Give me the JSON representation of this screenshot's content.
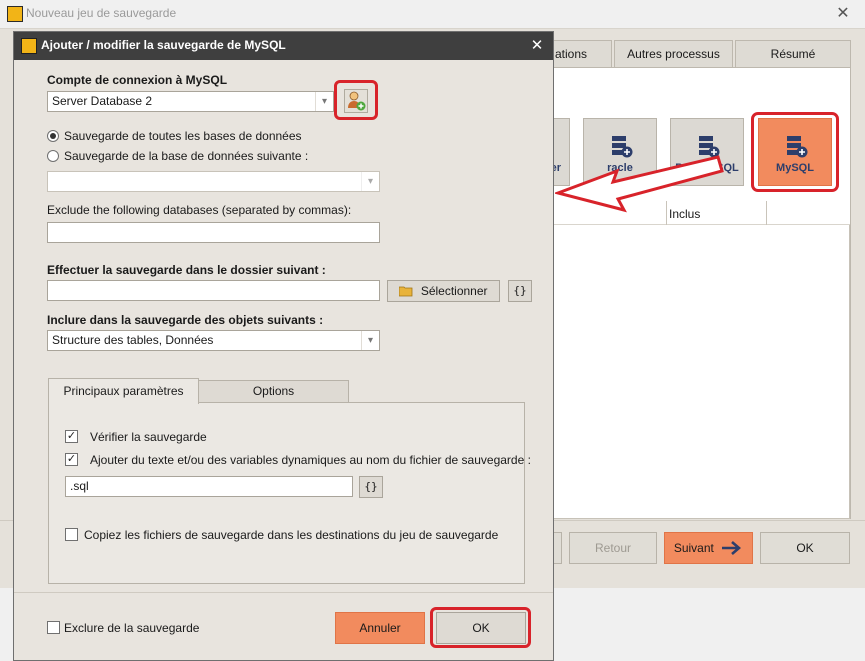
{
  "background_window": {
    "title": "Nouveau jeu de sauvegarde",
    "tabs": [
      "ations",
      "Autres processus",
      "Résumé"
    ],
    "db_buttons": [
      "er",
      "racle",
      "PostgreSQL",
      "MySQL"
    ],
    "grid_header_inclus": "Inclus",
    "footer_buttons": {
      "retour": "Retour",
      "suivant": "Suivant",
      "ok": "OK"
    }
  },
  "dialog": {
    "title": "Ajouter / modifier la sauvegarde de MySQL",
    "account_label": "Compte de connexion à MySQL",
    "account_value": "Server Database 2",
    "radio_all": "Sauvegarde de toutes les bases de données",
    "radio_single": "Sauvegarde de la base de données suivante :",
    "exclude_label": "Exclude the following databases (separated by commas):",
    "exclude_value": "",
    "folder_label": "Effectuer la sauvegarde dans le dossier suivant :",
    "folder_value": "",
    "select_button": "Sélectionner",
    "braces": "{}",
    "include_label": "Inclure dans la sauvegarde des objets suivants :",
    "include_value": "Structure des tables, Données",
    "tabs": {
      "main": "Principaux paramètres",
      "options": "Options"
    },
    "check_verify": "Vérifier la sauvegarde",
    "check_add_text": "Ajouter du texte et/ou des variables dynamiques au nom du fichier de sauvegarde :",
    "suffix_value": ".sql",
    "check_copy": "Copiez les fichiers de sauvegarde dans les destinations du jeu de sauvegarde",
    "exclude_from_backup": "Exclure de la sauvegarde",
    "cancel": "Annuler",
    "ok": "OK"
  },
  "colors": {
    "accent": "#f28b5e",
    "highlight": "#d8232a",
    "titlebar": "#3f3f3f"
  }
}
